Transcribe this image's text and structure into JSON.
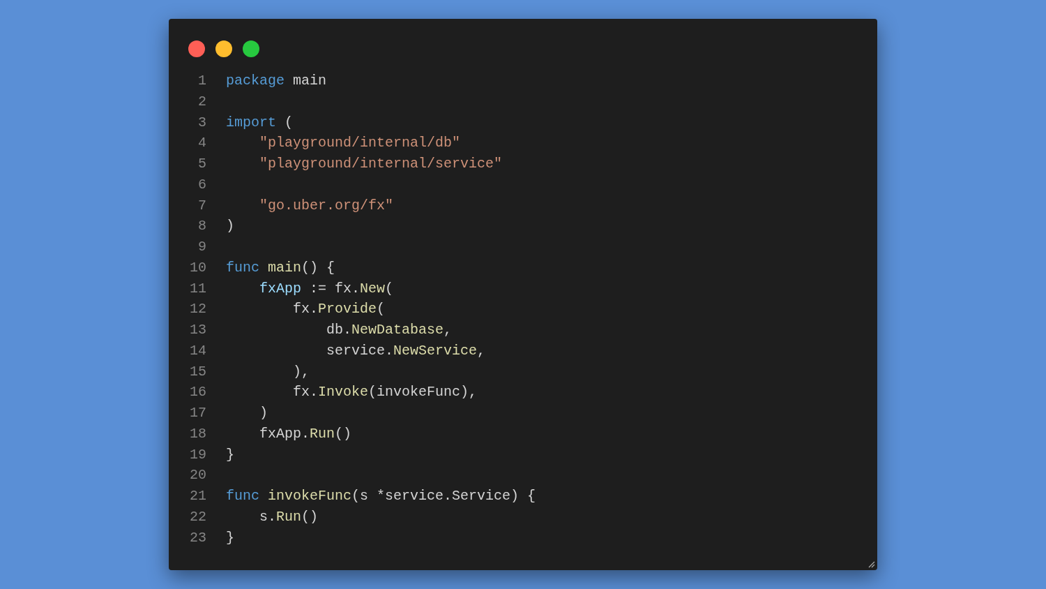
{
  "window": {
    "controls": [
      {
        "color": "#ff5f56"
      },
      {
        "color": "#ffbd2e"
      },
      {
        "color": "#27c93f"
      }
    ]
  },
  "code": [
    {
      "number": "1",
      "tokens": [
        {
          "text": "package",
          "kind": "keyword"
        },
        {
          "text": " main",
          "kind": "plain"
        }
      ]
    },
    {
      "number": "2"
    },
    {
      "number": "3",
      "tokens": [
        {
          "text": "import",
          "kind": "keyword"
        },
        {
          "text": " (",
          "kind": "plain"
        }
      ]
    },
    {
      "number": "4",
      "tokens": [
        {
          "text": "    \"playground/internal/db\"",
          "kind": "string"
        }
      ]
    },
    {
      "number": "5",
      "tokens": [
        {
          "text": "    \"playground/internal/service\"",
          "kind": "string"
        }
      ]
    },
    {
      "number": "6"
    },
    {
      "number": "7",
      "tokens": [
        {
          "text": "    \"go.uber.org/fx\"",
          "kind": "string"
        }
      ]
    },
    {
      "number": "8",
      "tokens": [
        {
          "text": ")",
          "kind": "plain"
        }
      ]
    },
    {
      "number": "9"
    },
    {
      "number": "10",
      "tokens": [
        {
          "text": "func",
          "kind": "keyword"
        },
        {
          "text": " main",
          "kind": "function"
        },
        {
          "text": "() {",
          "kind": "plain"
        }
      ]
    },
    {
      "number": "11",
      "tokens": [
        {
          "text": "    fxApp",
          "kind": "variable"
        },
        {
          "text": " := fx.",
          "kind": "plain"
        },
        {
          "text": "New",
          "kind": "function"
        },
        {
          "text": "(",
          "kind": "plain"
        }
      ]
    },
    {
      "number": "12",
      "tokens": [
        {
          "text": "        fx.",
          "kind": "plain"
        },
        {
          "text": "Provide",
          "kind": "function"
        },
        {
          "text": "(",
          "kind": "plain"
        }
      ]
    },
    {
      "number": "13",
      "tokens": [
        {
          "text": "            db.",
          "kind": "plain"
        },
        {
          "text": "NewDatabase",
          "kind": "function"
        },
        {
          "text": ",",
          "kind": "plain"
        }
      ]
    },
    {
      "number": "14",
      "tokens": [
        {
          "text": "            service.",
          "kind": "plain"
        },
        {
          "text": "NewService",
          "kind": "function"
        },
        {
          "text": ",",
          "kind": "plain"
        }
      ]
    },
    {
      "number": "15",
      "tokens": [
        {
          "text": "        ),",
          "kind": "plain"
        }
      ]
    },
    {
      "number": "16",
      "tokens": [
        {
          "text": "        fx.",
          "kind": "plain"
        },
        {
          "text": "Invoke",
          "kind": "function"
        },
        {
          "text": "(invokeFunc),",
          "kind": "plain"
        }
      ]
    },
    {
      "number": "17",
      "tokens": [
        {
          "text": "    )",
          "kind": "plain"
        }
      ]
    },
    {
      "number": "18",
      "tokens": [
        {
          "text": "    fxApp.",
          "kind": "plain"
        },
        {
          "text": "Run",
          "kind": "function"
        },
        {
          "text": "()",
          "kind": "plain"
        }
      ]
    },
    {
      "number": "19",
      "tokens": [
        {
          "text": "}",
          "kind": "plain"
        }
      ]
    },
    {
      "number": "20"
    },
    {
      "number": "21",
      "tokens": [
        {
          "text": "func",
          "kind": "keyword"
        },
        {
          "text": " invokeFunc",
          "kind": "function"
        },
        {
          "text": "(s *service.Service) {",
          "kind": "plain"
        }
      ]
    },
    {
      "number": "22",
      "tokens": [
        {
          "text": "    s.",
          "kind": "plain"
        },
        {
          "text": "Run",
          "kind": "function"
        },
        {
          "text": "()",
          "kind": "plain"
        }
      ]
    },
    {
      "number": "23",
      "tokens": [
        {
          "text": "}",
          "kind": "plain"
        }
      ]
    }
  ]
}
